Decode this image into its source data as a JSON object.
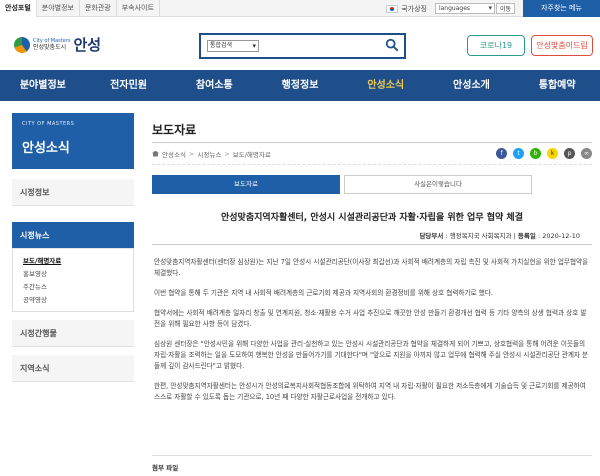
{
  "topbar": {
    "sites": [
      "안성포털",
      "분야별정보",
      "문화관광",
      "부속사이트"
    ],
    "gov_mark": "국가상징",
    "language": "languages",
    "go_label": "이동",
    "quick_label": "자주찾는 메뉴"
  },
  "header": {
    "logo_small": "City of Masters",
    "logo_sub": "안성맞춤도시",
    "logo_big": "안성",
    "search_select": "통합검색",
    "covid_button": "코로나19",
    "safety_button": "안성맞춤이드림"
  },
  "nav": {
    "items": [
      "분야별정보",
      "전자민원",
      "참여소통",
      "행정정보",
      "안성소식",
      "안성소개",
      "통합예약"
    ]
  },
  "sidebar": {
    "banner_small": "CITY OF MASTERS",
    "banner_title": "안성소식",
    "menu": [
      "시정정보",
      "시정뉴스",
      "시정간행물",
      "지역소식"
    ],
    "sub_items": [
      "보도/해명자료",
      "홍보영상",
      "주간뉴스",
      "공약영상"
    ]
  },
  "content": {
    "page_title": "보도자료",
    "breadcrumb": [
      "안성소식",
      "시정뉴스",
      "보도/해명자료"
    ],
    "tabs": [
      "보도자료",
      "사실은이렇습니다"
    ],
    "article_title": "안성맞춤지역자활센터, 안성시 시설관리공단과 자활·자립을 위한 업무 협약 체결",
    "meta_dept_label": "담당부서",
    "meta_dept": "행정복지국 사회복지과",
    "meta_date_label": "등록일",
    "meta_date": "2020-12-10",
    "paragraphs": [
      "안성맞춤지역자활센터(센터장 심상원)는 지난 7일 안성시 시설관리공단(이사장 최갑선)과 사회적 배려계층의 자립 촉진 및 사회적 가치실현을 위한 업무협약을 체결했다.",
      "이번 협약을 통해 두 기관은 지역 내 사회적 배려계층의 근로기회 제공과 지역사회의 환경정비를 위해 상호 협력하기로 했다.",
      "협약서에는 사회적 배려계층 일자리 창출 및 연계지원, 청소·재활용 수거 사업 추진으로 깨끗한 안성 만들기 환경개선 협력 등 기타 양측의 상생 협력과 상호 발전을 위해 필요한 사항 등이 담겼다.",
      "심상원 센터장은 \"안성시민을 위해 다양한 사업을 관리·실천하고 있는 안성시 시설관리공단과 협약을 체결하게 되어 기쁘고, 상호협력을 통해 어려운 이웃들의 자립·자활을 조력하는 일을 도모하여 행복한 안성을 만들어가기를 기대한다\"며 \"앞으로 지원을 아끼지 않고 업무에 협력해 주실 안성시 시설관리공단 관계자 분들께 깊이 감사드린다\"고 밝혔다.",
      "한편, 안성맞춤지역자활센터는 안성시가 안성의료복지사회적협동조합에 위탁하여 지역 내 자립·자활이 필요한 저소득층에게 기술습득 및 근로기회를 제공하여 스스로 자활할 수 있도록 돕는 기관으로, 10년 째 다양한 자활근로사업을 전개하고 있다."
    ],
    "attachment_label": "첨부 파일"
  },
  "colors": {
    "primary": "#1e4f8a",
    "accent": "#f2c94c",
    "covid": "#2e9a8d",
    "safety": "#e04d3c"
  },
  "icons": [
    "home-icon",
    "search-icon",
    "facebook-icon",
    "twitter-icon",
    "blog-icon",
    "kakao-icon",
    "print-icon",
    "link-icon"
  ]
}
